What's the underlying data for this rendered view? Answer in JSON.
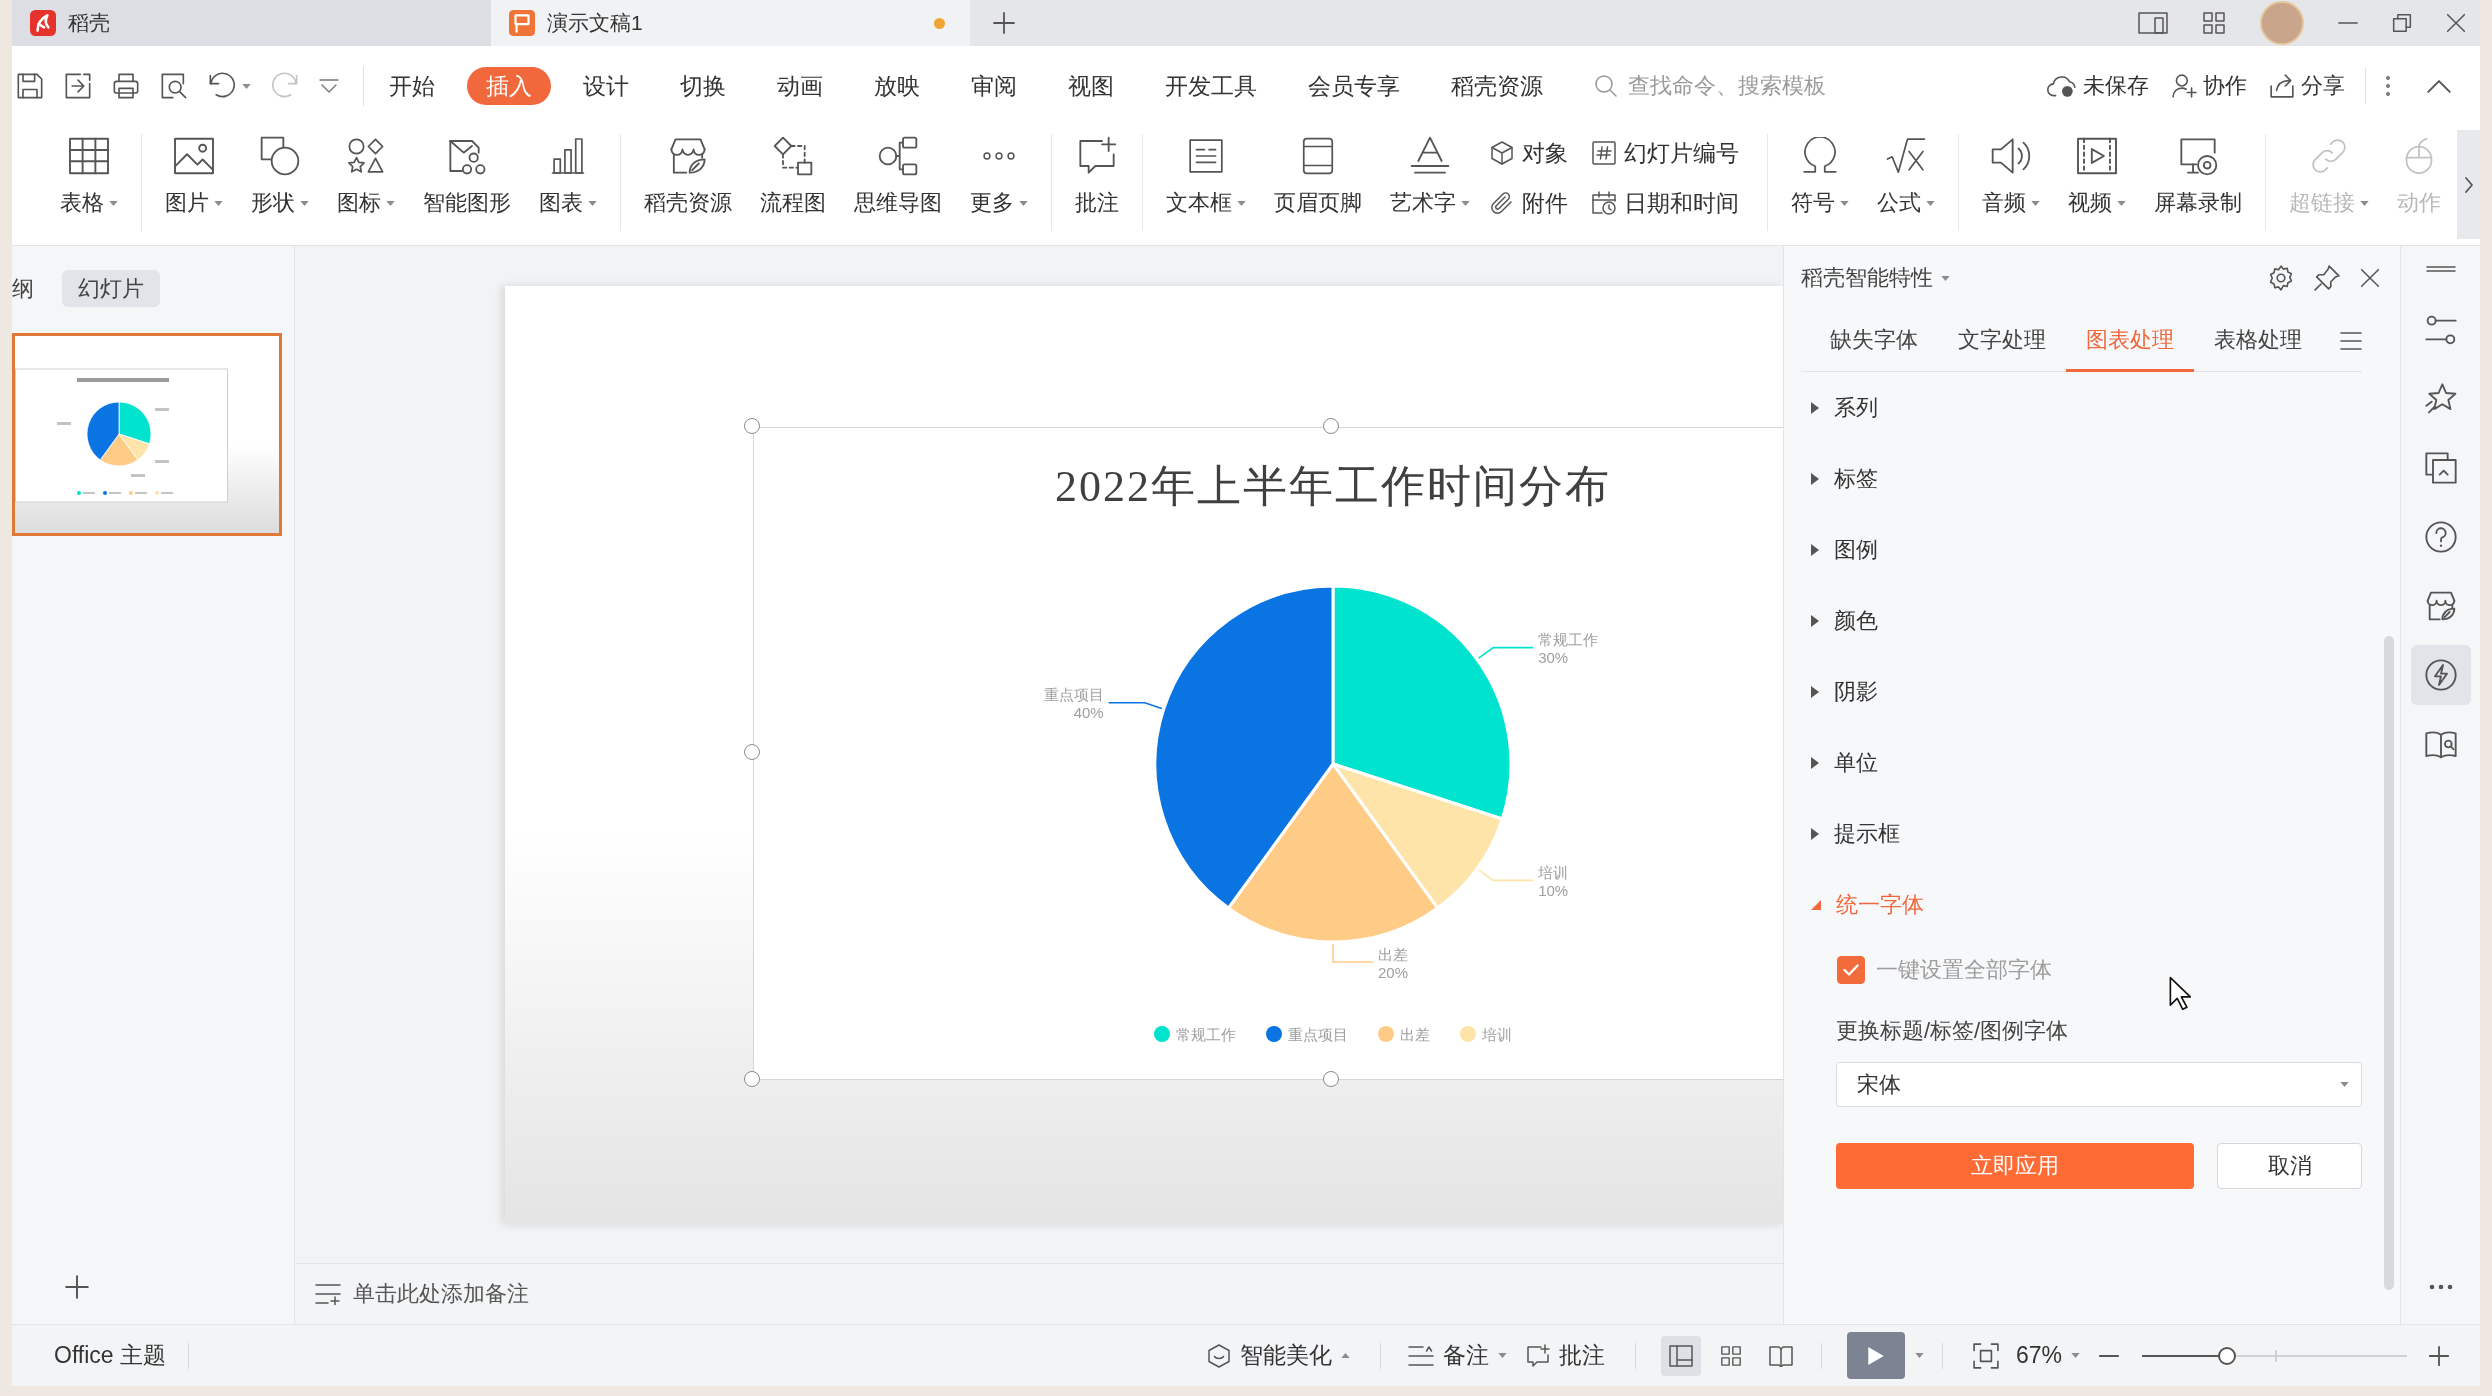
{
  "title_bar": {
    "tabs": [
      {
        "label": "稻壳",
        "kind": "home",
        "selected": false,
        "unsaved": false
      },
      {
        "label": "演示文稿1",
        "kind": "presentation",
        "selected": true,
        "unsaved": true
      }
    ]
  },
  "menu": {
    "items": [
      {
        "label": "开始",
        "selected": false
      },
      {
        "label": "插入",
        "selected": true
      },
      {
        "label": "设计",
        "selected": false
      },
      {
        "label": "切换",
        "selected": false
      },
      {
        "label": "动画",
        "selected": false
      },
      {
        "label": "放映",
        "selected": false
      },
      {
        "label": "审阅",
        "selected": false
      },
      {
        "label": "视图",
        "selected": false
      },
      {
        "label": "开发工具",
        "selected": false
      },
      {
        "label": "会员专享",
        "selected": false
      },
      {
        "label": "稻壳资源",
        "selected": false
      }
    ],
    "search": {
      "placeholder": "查找命令、搜索模板"
    },
    "actions": [
      {
        "label": "未保存"
      },
      {
        "label": "协作"
      },
      {
        "label": "分享"
      }
    ]
  },
  "ribbon": {
    "groups": [
      {
        "items": [
          {
            "label": "表格",
            "kind": "large",
            "dropdown": true,
            "disabled": false
          }
        ]
      },
      {
        "items": [
          {
            "label": "图片",
            "kind": "large",
            "dropdown": true,
            "disabled": false
          },
          {
            "label": "形状",
            "kind": "large",
            "dropdown": true,
            "disabled": false
          },
          {
            "label": "图标",
            "kind": "large",
            "dropdown": true,
            "disabled": false
          },
          {
            "label": "智能图形",
            "kind": "large",
            "dropdown": false,
            "disabled": false
          },
          {
            "label": "图表",
            "kind": "large",
            "dropdown": true,
            "disabled": false
          }
        ]
      },
      {
        "items": [
          {
            "label": "稻壳资源",
            "kind": "large",
            "dropdown": false,
            "disabled": false
          },
          {
            "label": "流程图",
            "kind": "large",
            "dropdown": false,
            "disabled": false
          },
          {
            "label": "思维导图",
            "kind": "large",
            "dropdown": false,
            "disabled": false
          },
          {
            "label": "更多",
            "kind": "large",
            "dropdown": true,
            "disabled": false
          }
        ]
      },
      {
        "items": [
          {
            "label": "批注",
            "kind": "large",
            "dropdown": false,
            "disabled": false
          }
        ]
      },
      {
        "items": [
          {
            "label": "文本框",
            "kind": "large",
            "dropdown": true,
            "disabled": false
          },
          {
            "label": "页眉页脚",
            "kind": "large",
            "dropdown": false,
            "disabled": false
          },
          {
            "label": "艺术字",
            "kind": "large",
            "dropdown": true,
            "disabled": false
          },
          {
            "label": "对象",
            "kind": "small",
            "dropdown": false,
            "disabled": false
          },
          {
            "label": "附件",
            "kind": "small",
            "dropdown": false,
            "disabled": false
          },
          {
            "label": "幻灯片编号",
            "kind": "small",
            "dropdown": false,
            "disabled": false
          },
          {
            "label": "日期和时间",
            "kind": "small",
            "dropdown": false,
            "disabled": false
          }
        ]
      },
      {
        "items": [
          {
            "label": "符号",
            "kind": "large",
            "dropdown": true,
            "disabled": false
          },
          {
            "label": "公式",
            "kind": "large",
            "dropdown": true,
            "disabled": false
          }
        ]
      },
      {
        "items": [
          {
            "label": "音频",
            "kind": "large",
            "dropdown": true,
            "disabled": false
          },
          {
            "label": "视频",
            "kind": "large",
            "dropdown": true,
            "disabled": false
          },
          {
            "label": "屏幕录制",
            "kind": "large",
            "dropdown": false,
            "disabled": false
          }
        ]
      },
      {
        "items": [
          {
            "label": "超链接",
            "kind": "large",
            "dropdown": true,
            "disabled": true
          },
          {
            "label": "动作",
            "kind": "large",
            "dropdown": false,
            "disabled": true
          }
        ]
      }
    ]
  },
  "left_panel": {
    "tabs": [
      {
        "label": "纲",
        "selected": false
      },
      {
        "label": "幻灯片",
        "selected": true
      }
    ],
    "slides": [
      {
        "selected": true
      }
    ]
  },
  "slide": {
    "chart": {
      "chart_data": {
        "type": "pie",
        "title": "2022年上半年工作时间分布",
        "categories": [
          "常规工作",
          "培训",
          "出差",
          "重点项目"
        ],
        "values": [
          30,
          10,
          20,
          40
        ],
        "value_labels": [
          "30%",
          "10%",
          "20%",
          "40%"
        ],
        "colors": [
          "#00e4cf",
          "#ffe4aa",
          "#ffcc88",
          "#0a74e2"
        ]
      },
      "legend": [
        {
          "label": "常规工作",
          "color": "#00e4cf"
        },
        {
          "label": "重点项目",
          "color": "#0a74e2"
        },
        {
          "label": "出差",
          "color": "#ffcc88"
        },
        {
          "label": "培训",
          "color": "#ffe4aa"
        }
      ]
    }
  },
  "notes": {
    "placeholder": "单击此处添加备注"
  },
  "task_pane": {
    "title": "稻壳智能特性",
    "tabs": [
      {
        "label": "缺失字体",
        "selected": false
      },
      {
        "label": "文字处理",
        "selected": false
      },
      {
        "label": "图表处理",
        "selected": true
      },
      {
        "label": "表格处理",
        "selected": false
      }
    ],
    "sections": [
      {
        "label": "系列",
        "expanded": false
      },
      {
        "label": "标签",
        "expanded": false
      },
      {
        "label": "图例",
        "expanded": false
      },
      {
        "label": "颜色",
        "expanded": false
      },
      {
        "label": "阴影",
        "expanded": false
      },
      {
        "label": "单位",
        "expanded": false
      },
      {
        "label": "提示框",
        "expanded": false
      },
      {
        "label": "统一字体",
        "expanded": true
      }
    ],
    "options": {
      "checkbox": {
        "label": "一键设置全部字体",
        "checked": true
      },
      "font_label": "更换标题/标签/图例字体",
      "font_select": {
        "value": "宋体"
      },
      "buttons": [
        {
          "label": "立即应用",
          "kind": "primary"
        },
        {
          "label": "取消",
          "kind": "secondary"
        }
      ]
    }
  },
  "side_toolbar": {
    "items": [
      {
        "selected": false
      },
      {
        "selected": false
      },
      {
        "selected": false
      },
      {
        "selected": false
      },
      {
        "selected": false
      },
      {
        "selected": true
      },
      {
        "selected": false
      }
    ]
  },
  "status_bar": {
    "theme": "Office 主题",
    "buttons": [
      {
        "label": "智能美化",
        "kind": "dropup"
      },
      {
        "label": "备注",
        "kind": "dropdown"
      },
      {
        "label": "批注",
        "kind": "plain"
      }
    ],
    "views": [
      {
        "selected": true
      },
      {
        "selected": false
      },
      {
        "selected": false
      }
    ],
    "zoom": "67%",
    "zoom_slider": {
      "level": 0.32
    }
  }
}
